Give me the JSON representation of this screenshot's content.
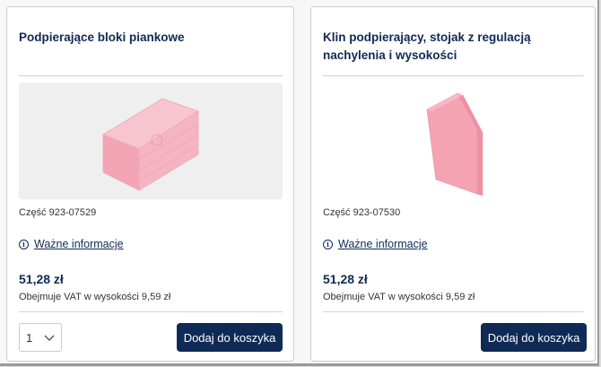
{
  "products": [
    {
      "title": "Podpierające bloki piankowe",
      "part": "Część 923-07529",
      "info_link": "Ważne informacje",
      "price": "51,28 zł",
      "vat": "Obejmuje VAT w wysokości 9,59 zł",
      "quantity": "1",
      "add_label": "Dodaj do koszyka"
    },
    {
      "title": "Klin podpierający, stojak z regulacją nachylenia i wysokości",
      "part": "Część 923-07530",
      "info_link": "Ważne informacje",
      "price": "51,28 zł",
      "vat": "Obejmuje VAT w wysokości 9,59 zł",
      "add_label": "Dodaj do koszyka"
    }
  ],
  "colors": {
    "brand_navy": "#0f2a55",
    "foam_pink": "#f5a9b8"
  },
  "icons": [
    "info-icon",
    "chevron-down-icon"
  ]
}
